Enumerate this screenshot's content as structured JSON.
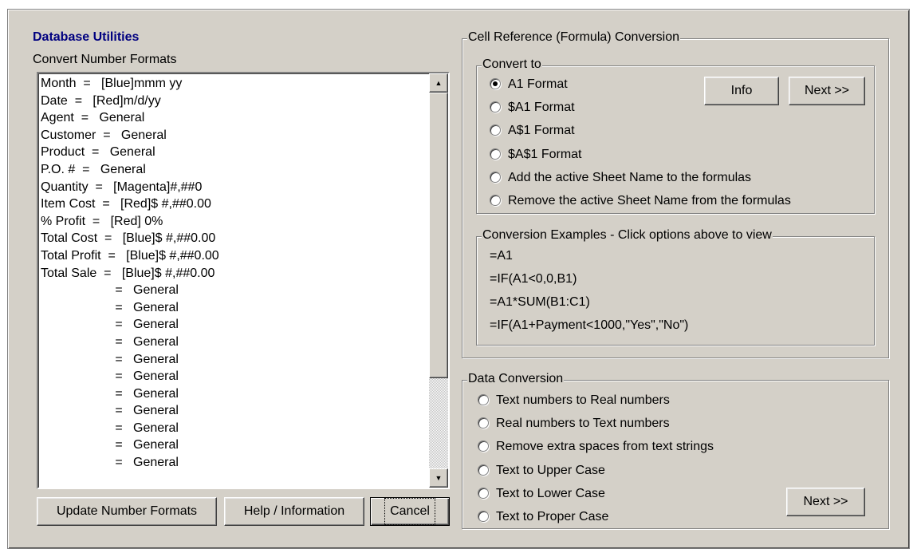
{
  "header": {
    "title": "Database Utilities",
    "subtitle": "Convert Number Formats"
  },
  "number_formats": [
    "Month  =   [Blue]mmm yy",
    "Date  =   [Red]m/d/yy",
    "Agent  =   General",
    "Customer  =   General",
    "Product  =   General",
    "P.O. #  =   General",
    "Quantity  =   [Magenta]#,##0",
    "Item Cost  =   [Red]$ #,##0.00",
    "% Profit  =   [Red] 0%",
    "Total Cost  =   [Blue]$ #,##0.00",
    "Total Profit  =   [Blue]$ #,##0.00",
    "Total Sale  =   [Blue]$ #,##0.00",
    "                     =   General",
    "                     =   General",
    "                     =   General",
    "                     =   General",
    "                     =   General",
    "                     =   General",
    "                     =   General",
    "                     =   General",
    "                     =   General",
    "                     =   General",
    "                     =   General"
  ],
  "buttons": {
    "update": "Update Number Formats",
    "help": "Help / Information",
    "cancel": "Cancel",
    "info": "Info",
    "next_ref": "Next >>",
    "next_data": "Next >>"
  },
  "cell_ref": {
    "group_label": "Cell Reference (Formula) Conversion",
    "convert_to_label": "Convert to",
    "options": [
      {
        "label": "A1 Format",
        "checked": true
      },
      {
        "label": "$A1 Format",
        "checked": false
      },
      {
        "label": "A$1 Format",
        "checked": false
      },
      {
        "label": "$A$1 Format",
        "checked": false
      },
      {
        "label": "Add the active Sheet Name to the formulas",
        "checked": false
      },
      {
        "label": "Remove the active Sheet Name from the formulas",
        "checked": false
      }
    ],
    "examples_label": "Conversion Examples - Click options above to view",
    "examples": [
      "=A1",
      "=IF(A1<0,0,B1)",
      "=A1*SUM(B1:C1)",
      "=IF(A1+Payment<1000,\"Yes\",\"No\")"
    ]
  },
  "data_conversion": {
    "group_label": "Data Conversion",
    "options": [
      {
        "label": "Text numbers to Real numbers",
        "checked": false
      },
      {
        "label": "Real numbers to Text numbers",
        "checked": false
      },
      {
        "label": "Remove extra spaces from text strings",
        "checked": false
      },
      {
        "label": "Text to Upper Case",
        "checked": false
      },
      {
        "label": "Text to Lower Case",
        "checked": false
      },
      {
        "label": "Text to Proper Case",
        "checked": false
      }
    ]
  }
}
